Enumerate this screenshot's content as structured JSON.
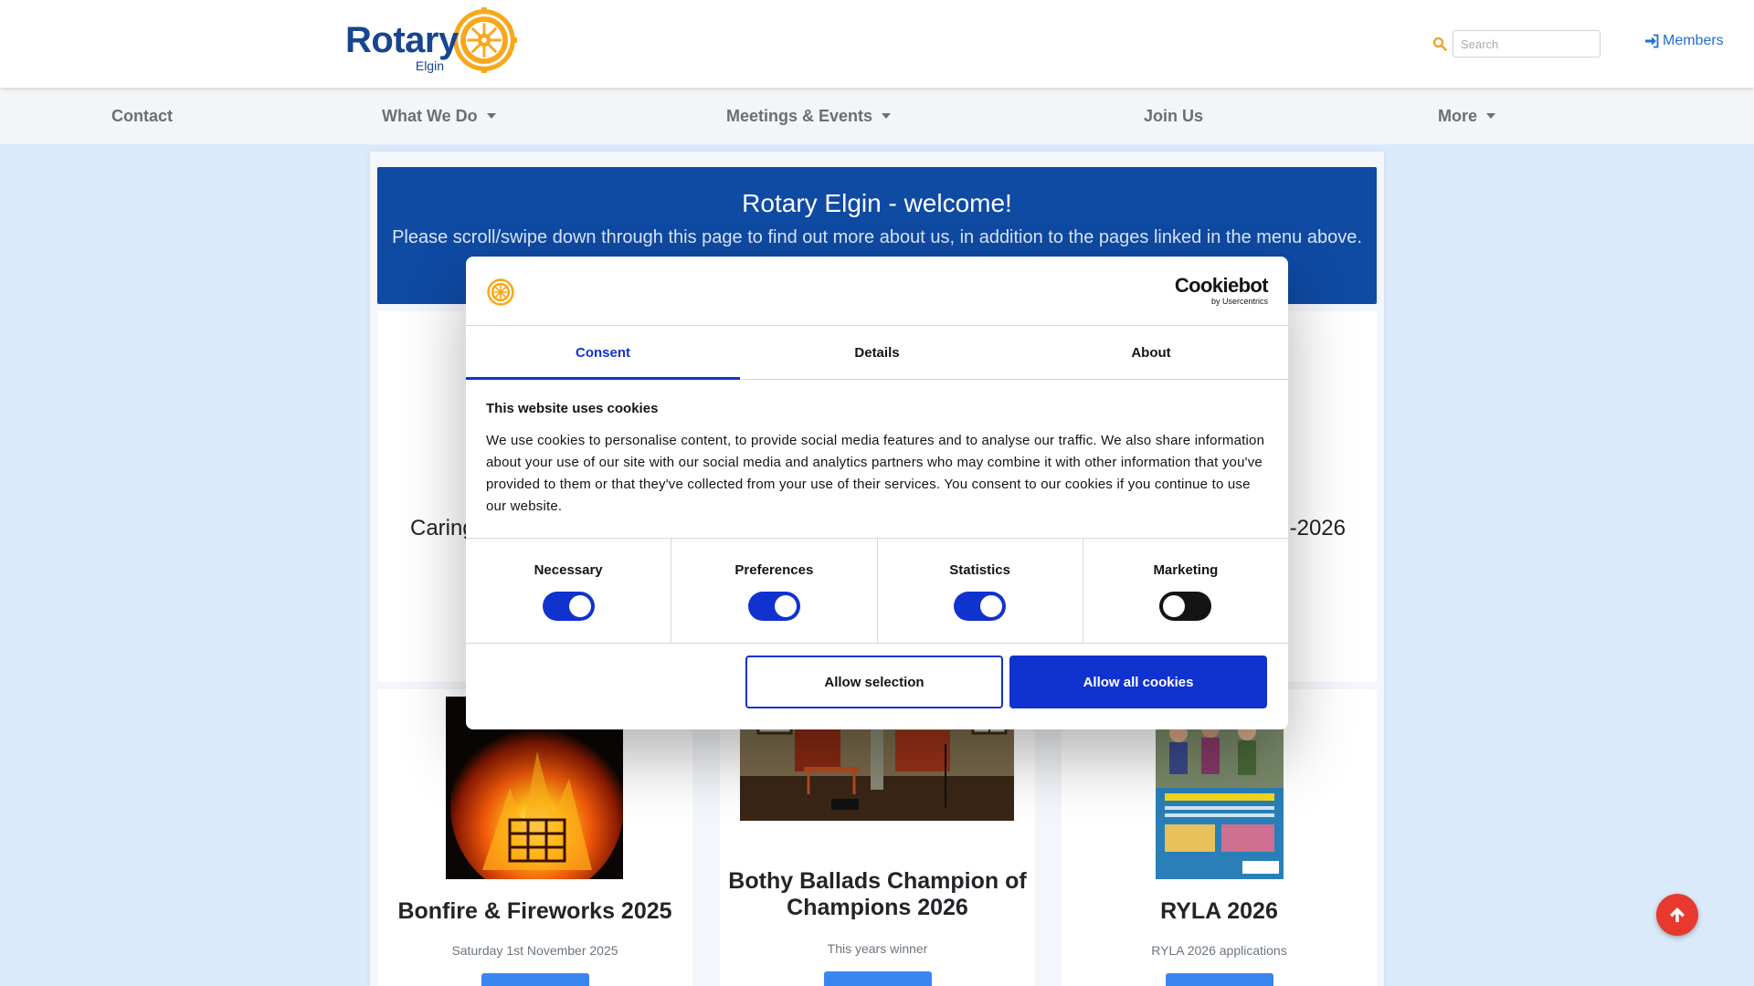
{
  "header": {
    "logo_word": "Rotary",
    "logo_sub": "Elgin",
    "search_placeholder": "Search",
    "members_label": "Members"
  },
  "nav": {
    "items": [
      {
        "label": "Contact",
        "dropdown": false
      },
      {
        "label": "What We Do",
        "dropdown": true
      },
      {
        "label": "Meetings & Events",
        "dropdown": true
      },
      {
        "label": "Join Us",
        "dropdown": false
      },
      {
        "label": "More",
        "dropdown": true
      }
    ]
  },
  "hero": {
    "title": "Rotary Elgin - welcome!",
    "subtitle": "Please scroll/swipe down through this page to find out more about us, in addition to the pages linked in the menu above."
  },
  "wide_card": {
    "left_text": "Caring",
    "right_text": "-2026"
  },
  "cards": [
    {
      "title": "Bonfire & Fireworks 2025",
      "subtitle": "Saturday 1st November 2025"
    },
    {
      "title": "Bothy Ballads Champion of Champions 2026",
      "subtitle": "This years winner"
    },
    {
      "title": "RYLA 2026",
      "subtitle": "RYLA 2026 applications"
    }
  ],
  "cookie_dialog": {
    "brand_word": "Cookiebot",
    "brand_by": "by Usercentrics",
    "tabs": [
      "Consent",
      "Details",
      "About"
    ],
    "active_tab": "Consent",
    "heading": "This website uses cookies",
    "body": "We use cookies to personalise content, to provide social media features and to analyse our traffic. We also share information about your use of our site with our social media and analytics partners who may combine it with other information that you've provided to them or that they've collected from your use of their services. You consent to our cookies if you continue to use our website.",
    "categories": [
      {
        "label": "Necessary",
        "enabled": true
      },
      {
        "label": "Preferences",
        "enabled": true
      },
      {
        "label": "Statistics",
        "enabled": true
      },
      {
        "label": "Marketing",
        "enabled": false
      }
    ],
    "allow_selection_label": "Allow selection",
    "allow_all_label": "Allow all cookies"
  },
  "colors": {
    "rotary_blue": "#17458f",
    "rotary_gold": "#f7a81b",
    "cookiebot_blue": "#1032cf",
    "page_background": "#dbeafb",
    "fab_red": "#e8392f"
  },
  "icons": {
    "search": "search-icon",
    "members": "sign-in-icon",
    "scroll_top": "arrow-up-icon",
    "logo": "rotary-wheel-icon"
  }
}
